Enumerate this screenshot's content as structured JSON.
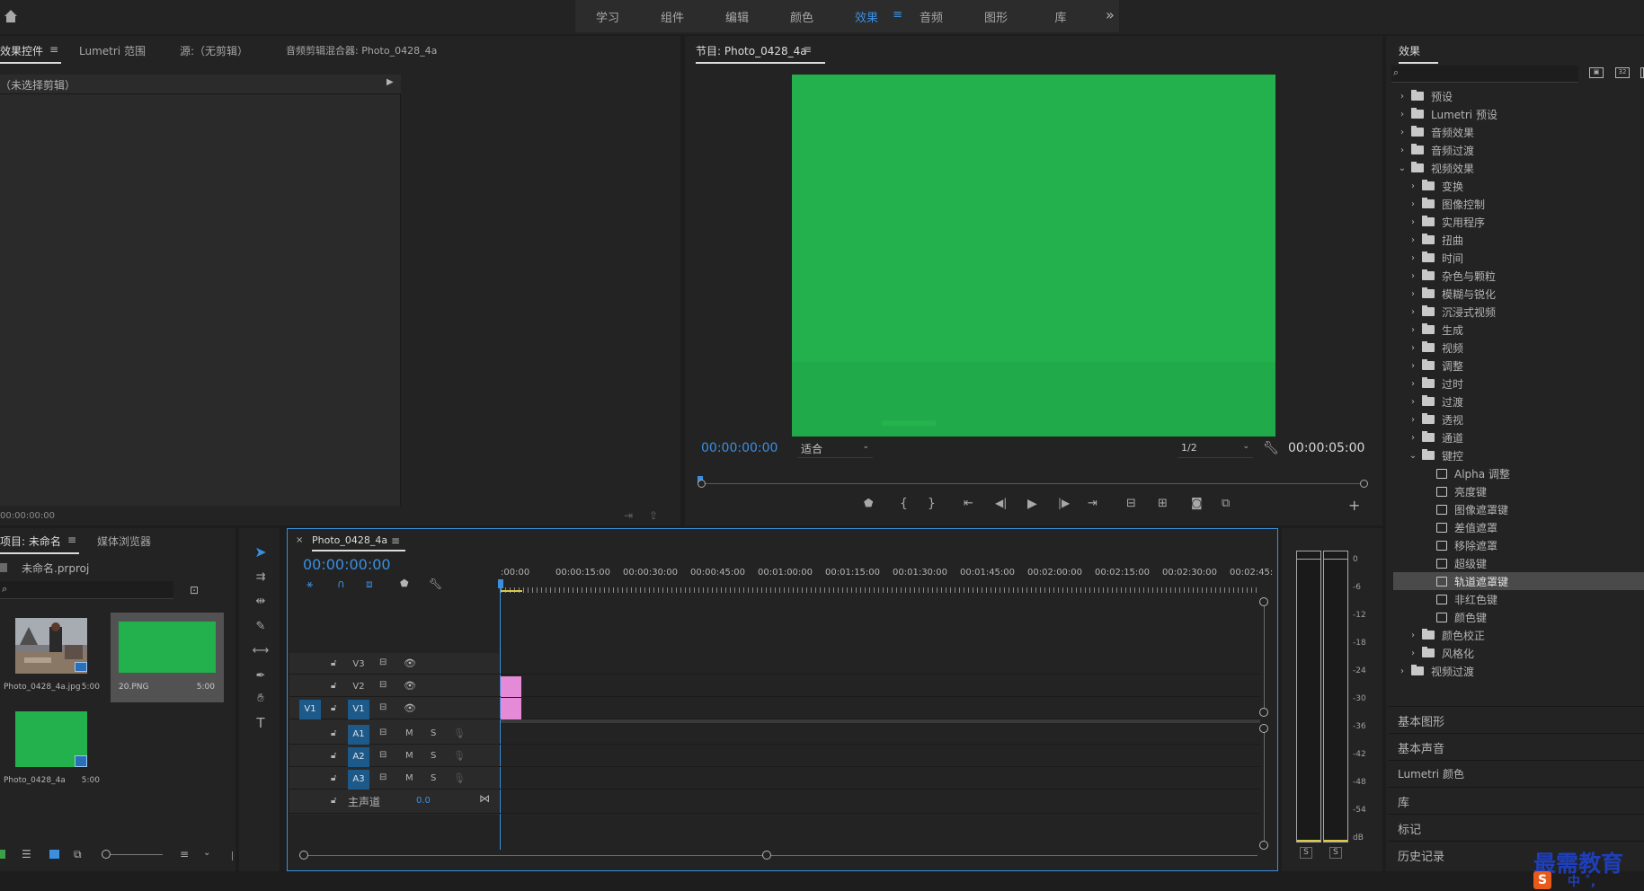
{
  "workspaces": [
    "学习",
    "组件",
    "编辑",
    "颜色",
    "效果",
    "音频",
    "图形",
    "库"
  ],
  "active_workspace": "效果",
  "more_glyph": "»",
  "source_panel": {
    "tabs": [
      "效果控件",
      "Lumetri 范围",
      "源:（无剪辑）",
      "音频剪辑混合器: Photo_0428_4a"
    ],
    "no_clip": "（未选择剪辑）",
    "timecode": "00:00:00:00"
  },
  "program_monitor": {
    "title": "节目: Photo_0428_4a",
    "timecode_current": "00:00:00:00",
    "fit": "适合",
    "resolution": "1/2",
    "timecode_duration": "00:00:05:00",
    "frame_color": "#22b14c"
  },
  "project_panel": {
    "tabs": [
      "项目: 未命名",
      "媒体浏览器"
    ],
    "file": "未命名.prproj",
    "items": [
      {
        "name": "Photo_0428_4a.jpg",
        "duration": "5:00"
      },
      {
        "name": "20.PNG",
        "duration": "5:00"
      },
      {
        "name": "Photo_0428_4a",
        "duration": "5:00"
      }
    ]
  },
  "timeline": {
    "sequence": "Photo_0428_4a",
    "timecode": "00:00:00:00",
    "ruler": [
      ":00:00",
      "00:00:15:00",
      "00:00:30:00",
      "00:00:45:00",
      "00:01:00:00",
      "00:01:15:00",
      "00:01:30:00",
      "00:01:45:00",
      "00:02:00:00",
      "00:02:15:00",
      "00:02:30:00",
      "00:02:45:"
    ],
    "video_tracks": [
      "V3",
      "V2",
      "V1"
    ],
    "audio_tracks": [
      "A1",
      "A2",
      "A3"
    ],
    "source_patch": "V1",
    "master_label": "主声道",
    "master_value": "0.0",
    "m_label": "M",
    "s_label": "S",
    "clip_color": "#e48ad6"
  },
  "audio_meter": {
    "scale": [
      "0",
      "-6",
      "-12",
      "-18",
      "-24",
      "-30",
      "-36",
      "-42",
      "-48",
      "-54",
      "dB"
    ],
    "solo": [
      "S",
      "S"
    ]
  },
  "effects_panel": {
    "title": "效果",
    "tree": [
      {
        "label": "预设",
        "level": 0,
        "open": false,
        "kind": "folder-star"
      },
      {
        "label": "Lumetri 预设",
        "level": 0,
        "open": false,
        "kind": "folder-star"
      },
      {
        "label": "音频效果",
        "level": 0,
        "open": false,
        "kind": "folder"
      },
      {
        "label": "音频过渡",
        "level": 0,
        "open": false,
        "kind": "folder"
      },
      {
        "label": "视频效果",
        "level": 0,
        "open": true,
        "kind": "folder"
      },
      {
        "label": "变换",
        "level": 1,
        "open": false,
        "kind": "folder"
      },
      {
        "label": "图像控制",
        "level": 1,
        "open": false,
        "kind": "folder"
      },
      {
        "label": "实用程序",
        "level": 1,
        "open": false,
        "kind": "folder"
      },
      {
        "label": "扭曲",
        "level": 1,
        "open": false,
        "kind": "folder"
      },
      {
        "label": "时间",
        "level": 1,
        "open": false,
        "kind": "folder"
      },
      {
        "label": "杂色与颗粒",
        "level": 1,
        "open": false,
        "kind": "folder"
      },
      {
        "label": "模糊与锐化",
        "level": 1,
        "open": false,
        "kind": "folder"
      },
      {
        "label": "沉浸式视频",
        "level": 1,
        "open": false,
        "kind": "folder"
      },
      {
        "label": "生成",
        "level": 1,
        "open": false,
        "kind": "folder"
      },
      {
        "label": "视频",
        "level": 1,
        "open": false,
        "kind": "folder"
      },
      {
        "label": "调整",
        "level": 1,
        "open": false,
        "kind": "folder"
      },
      {
        "label": "过时",
        "level": 1,
        "open": false,
        "kind": "folder"
      },
      {
        "label": "过渡",
        "level": 1,
        "open": false,
        "kind": "folder"
      },
      {
        "label": "透视",
        "level": 1,
        "open": false,
        "kind": "folder"
      },
      {
        "label": "通道",
        "level": 1,
        "open": false,
        "kind": "folder"
      },
      {
        "label": "键控",
        "level": 1,
        "open": true,
        "kind": "folder"
      },
      {
        "label": "Alpha 调整",
        "level": 2,
        "kind": "preset"
      },
      {
        "label": "亮度键",
        "level": 2,
        "kind": "preset"
      },
      {
        "label": "图像遮罩键",
        "level": 2,
        "kind": "preset"
      },
      {
        "label": "差值遮罩",
        "level": 2,
        "kind": "preset"
      },
      {
        "label": "移除遮罩",
        "level": 2,
        "kind": "preset"
      },
      {
        "label": "超级键",
        "level": 2,
        "kind": "preset"
      },
      {
        "label": "轨道遮罩键",
        "level": 2,
        "kind": "preset",
        "selected": true
      },
      {
        "label": "非红色键",
        "level": 2,
        "kind": "preset"
      },
      {
        "label": "颜色键",
        "level": 2,
        "kind": "preset"
      },
      {
        "label": "颜色校正",
        "level": 1,
        "open": false,
        "kind": "folder"
      },
      {
        "label": "风格化",
        "level": 1,
        "open": false,
        "kind": "folder"
      },
      {
        "label": "视频过渡",
        "level": 0,
        "open": false,
        "kind": "folder"
      }
    ],
    "sections": [
      "基本图形",
      "基本声音",
      "Lumetri 颜色",
      "库",
      "标记",
      "历史记录"
    ]
  },
  "watermark": {
    "text": "最需教育",
    "sub": "中 ˚,"
  }
}
